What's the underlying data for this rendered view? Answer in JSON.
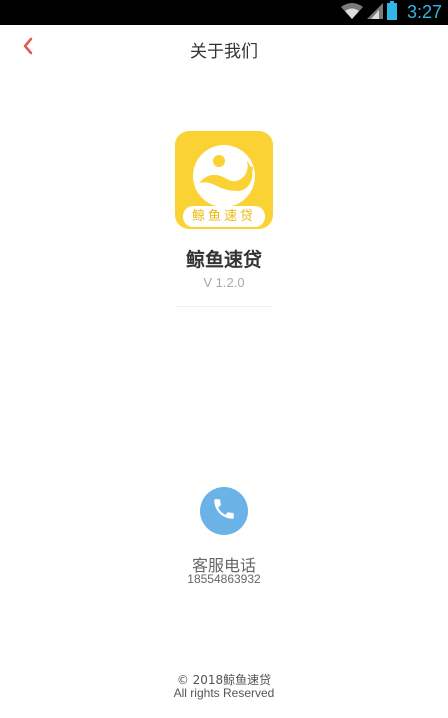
{
  "status_bar": {
    "time": "3:27",
    "icons": [
      "wifi-icon",
      "signal-icon",
      "battery-icon"
    ],
    "time_color": "#33b5e5"
  },
  "header": {
    "title": "关于我们",
    "back_icon": "chevron-left-icon",
    "back_color": "#e05a4f"
  },
  "app": {
    "logo_label": "鲸鱼速贷",
    "name": "鲸鱼速贷",
    "version": "V 1.2.0",
    "logo_color": "#fbd234"
  },
  "contact": {
    "icon": "phone-icon",
    "label": "客服电话",
    "number": "18554863932",
    "icon_color": "#6bb3e6"
  },
  "footer": {
    "copyright": "© 2018鲸鱼速贷",
    "rights": "All rights Reserved"
  }
}
